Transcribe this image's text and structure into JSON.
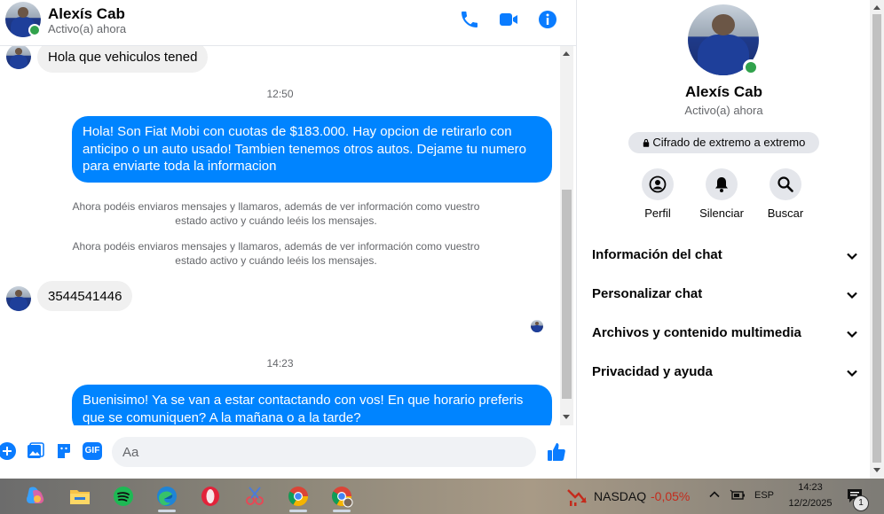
{
  "header": {
    "name": "Alexís Cab",
    "status": "Activo(a) ahora"
  },
  "messages": {
    "in_first": "Hola que vehiculos tened",
    "time_1": "12:50",
    "out_1": "Hola! Son Fiat Mobi con cuotas de $183.000. Hay opcion de retirarlo con anticipo o un auto usado! Tambien tenemos otros autos. Dejame tu numero para enviarte toda la informacion",
    "sys_1": "Ahora podéis enviaros mensajes y llamaros, además de ver información como vuestro estado activo y cuándo leéis los mensajes.",
    "sys_2": "Ahora podéis enviaros mensajes y llamaros, además de ver información como vuestro estado activo y cuándo leéis los mensajes.",
    "in_phone": "3544541446",
    "time_2": "14:23",
    "out_2": "Buenisimo! Ya se van a estar contactando con vos! En que horario preferis que se comuniquen? A la mañana o a la tarde?"
  },
  "composer": {
    "placeholder": "Aa",
    "gif_label": "GIF"
  },
  "side": {
    "name": "Alexís Cab",
    "status": "Activo(a) ahora",
    "encrypt": "Cifrado de extremo a extremo",
    "actions": [
      {
        "label": "Perfil",
        "icon": "profile-icon"
      },
      {
        "label": "Silenciar",
        "icon": "bell-icon"
      },
      {
        "label": "Buscar",
        "icon": "search-icon"
      }
    ],
    "rows": [
      {
        "label": "Información del chat"
      },
      {
        "label": "Personalizar chat"
      },
      {
        "label": "Archivos y contenido multimedia"
      },
      {
        "label": "Privacidad y ayuda"
      }
    ]
  },
  "taskbar": {
    "stock_name": "NASDAQ",
    "stock_change": "-0,05%",
    "lang": "ESP",
    "time": "14:23",
    "date": "12/2/2025",
    "notif_count": "1"
  },
  "colors": {
    "accent": "#0084ff",
    "icon_blue": "#0a7cff",
    "online": "#31a24c",
    "bubble_in": "#f0f0f0"
  }
}
